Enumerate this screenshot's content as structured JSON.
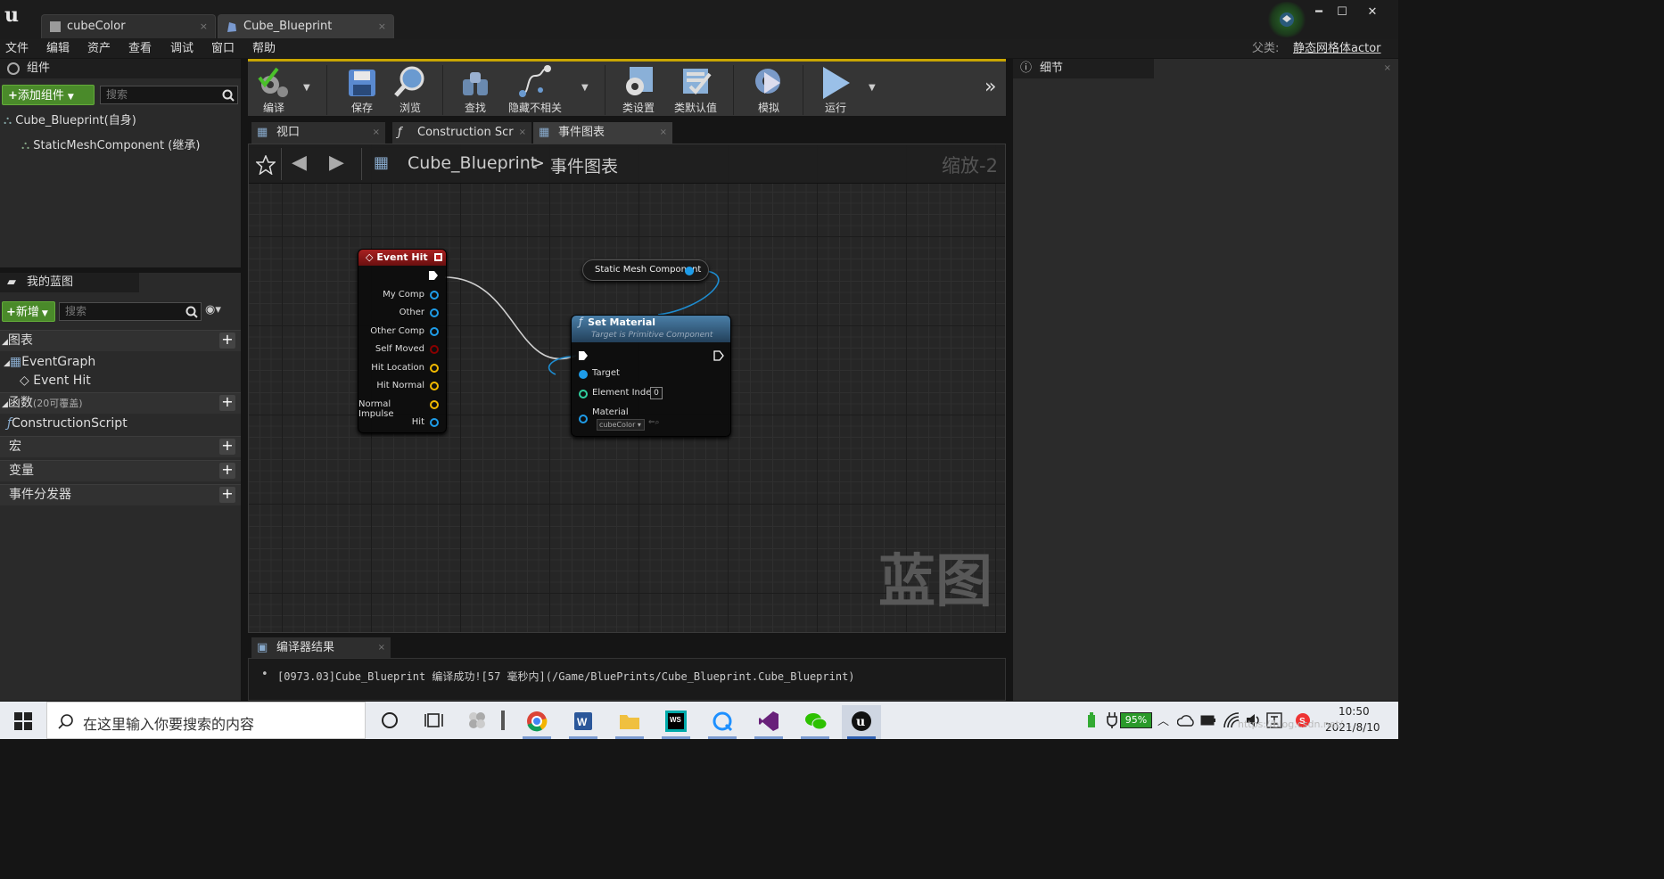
{
  "tabs": [
    {
      "label": "cubeColor",
      "close": "×"
    },
    {
      "label": "Cube_Blueprint",
      "close": "×"
    }
  ],
  "window": {
    "minimize": "━",
    "maximize": "☐",
    "close": "✕"
  },
  "menu": [
    "文件",
    "编辑",
    "资产",
    "查看",
    "调试",
    "窗口",
    "帮助"
  ],
  "parent": {
    "label": "父类:",
    "value": "静态网格体actor"
  },
  "components": {
    "title": "组件",
    "add_label": "添加组件",
    "search_placeholder": "搜索",
    "root": "Cube_Blueprint(自身)",
    "child": "StaticMeshComponent (继承)"
  },
  "myblueprint": {
    "title": "我的蓝图",
    "new_label": "新增",
    "search_placeholder": "搜索",
    "graphs_label": "图表",
    "event_graph": "EventGraph",
    "event_hit": "Event Hit",
    "functions_label": "函数",
    "functions_note": "(20可覆盖)",
    "construction": "ConstructionScript",
    "macros_label": "宏",
    "variables_label": "变量",
    "dispatchers_label": "事件分发器"
  },
  "toolbar": [
    {
      "label": "编译",
      "icon": "compile-icon"
    },
    {
      "label": "保存",
      "icon": "save-icon"
    },
    {
      "label": "浏览",
      "icon": "browse-icon"
    },
    {
      "label": "查找",
      "icon": "find-icon"
    },
    {
      "label": "隐藏不相关",
      "icon": "hide-unrelated-icon"
    },
    {
      "label": "类设置",
      "icon": "class-settings-icon"
    },
    {
      "label": "类默认值",
      "icon": "class-defaults-icon"
    },
    {
      "label": "模拟",
      "icon": "simulate-icon"
    },
    {
      "label": "运行",
      "icon": "play-icon"
    }
  ],
  "doctabs": [
    {
      "label": "视口"
    },
    {
      "label": "Construction Scrip"
    },
    {
      "label": "事件图表"
    }
  ],
  "graph": {
    "bp_name": "Cube_Blueprint",
    "sep": ">",
    "graph_name": "事件图表",
    "zoom": "缩放-2",
    "watermark": "蓝图"
  },
  "node_event_hit": {
    "title": "Event Hit",
    "pins": [
      "My Comp",
      "Other",
      "Other Comp",
      "Self Moved",
      "Hit Location",
      "Hit Normal",
      "Normal Impulse",
      "Hit"
    ]
  },
  "node_static_mesh": {
    "label": "Static Mesh Component"
  },
  "node_set_material": {
    "title": "Set Material",
    "subtitle": "Target is Primitive Component",
    "target": "Target",
    "element_index": "Element Index",
    "element_index_value": "0",
    "material": "Material",
    "material_value": "cubeColor"
  },
  "details": {
    "title": "细节"
  },
  "log": {
    "tab": "编译器结果",
    "line": "[0973.03]Cube_Blueprint 编译成功![57 毫秒内](/Game/BluePrints/Cube_Blueprint.Cube_Blueprint)"
  },
  "taskbar": {
    "search_placeholder": "在这里输入你要搜索的内容",
    "battery": "95%",
    "time": "10:50",
    "date": "2021/8/10",
    "watermark": "https://blog.csdn.net/..."
  },
  "colors": {
    "accent_green": "#4a8a2a",
    "exec": "#ffffff",
    "object_pin": "#00a8f0",
    "bool_pin": "#8b0000",
    "vector_pin": "#f0b800",
    "int_pin": "#30d0a0",
    "event_header": "#a01b1b",
    "function_header": "#3a6f94"
  }
}
